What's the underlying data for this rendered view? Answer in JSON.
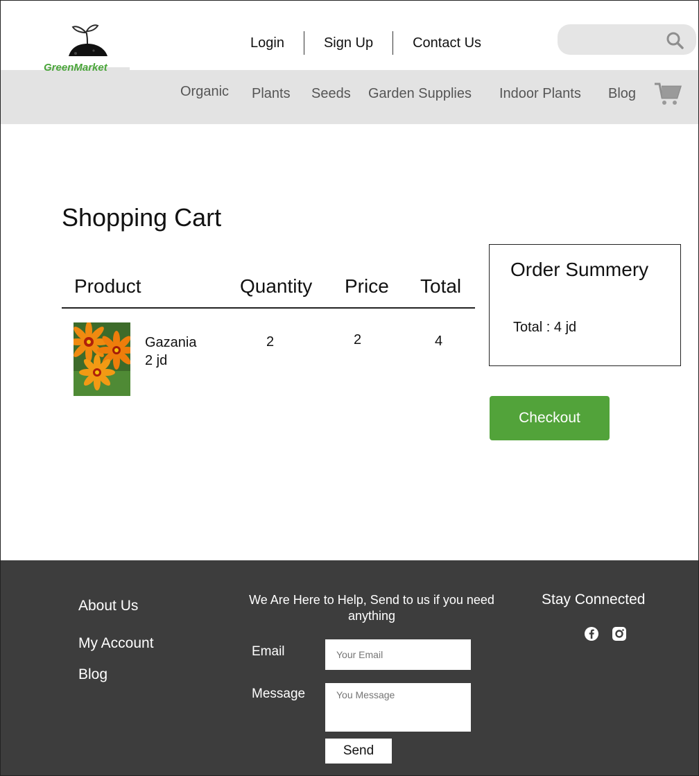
{
  "brand": {
    "name": "GreenMarket"
  },
  "header": {
    "links": [
      {
        "label": "Login"
      },
      {
        "label": "Sign Up"
      },
      {
        "label": "Contact Us"
      }
    ],
    "search": {
      "placeholder": ""
    }
  },
  "nav": {
    "items": [
      "Organic",
      "Plants",
      "Seeds",
      "Garden Supplies",
      "Indoor Plants",
      "Blog"
    ]
  },
  "cart": {
    "title": "Shopping Cart",
    "columns": [
      "Product",
      "Quantity",
      "Price",
      "Total"
    ],
    "items": [
      {
        "name": "Gazania",
        "unit_price_label": "2 jd",
        "quantity": "2",
        "price": "2",
        "total": "4"
      }
    ]
  },
  "summary": {
    "title": "Order Summery",
    "total_label": "Total : 4 jd",
    "checkout_label": "Checkout"
  },
  "footer": {
    "links": [
      "About Us",
      "My Account",
      "Blog"
    ],
    "help_text": "We Are Here to Help, Send to us if you need anything",
    "email_label": "Email",
    "email_placeholder": "Your Email",
    "message_label": "Message",
    "message_placeholder": "You Message",
    "send_label": "Send",
    "stay_connected": "Stay Connected"
  },
  "colors": {
    "accent": "#52a33a",
    "brand_text": "#4aa53a",
    "nav_bg": "#e3e3e3",
    "footer_bg": "#3d3d3d"
  }
}
